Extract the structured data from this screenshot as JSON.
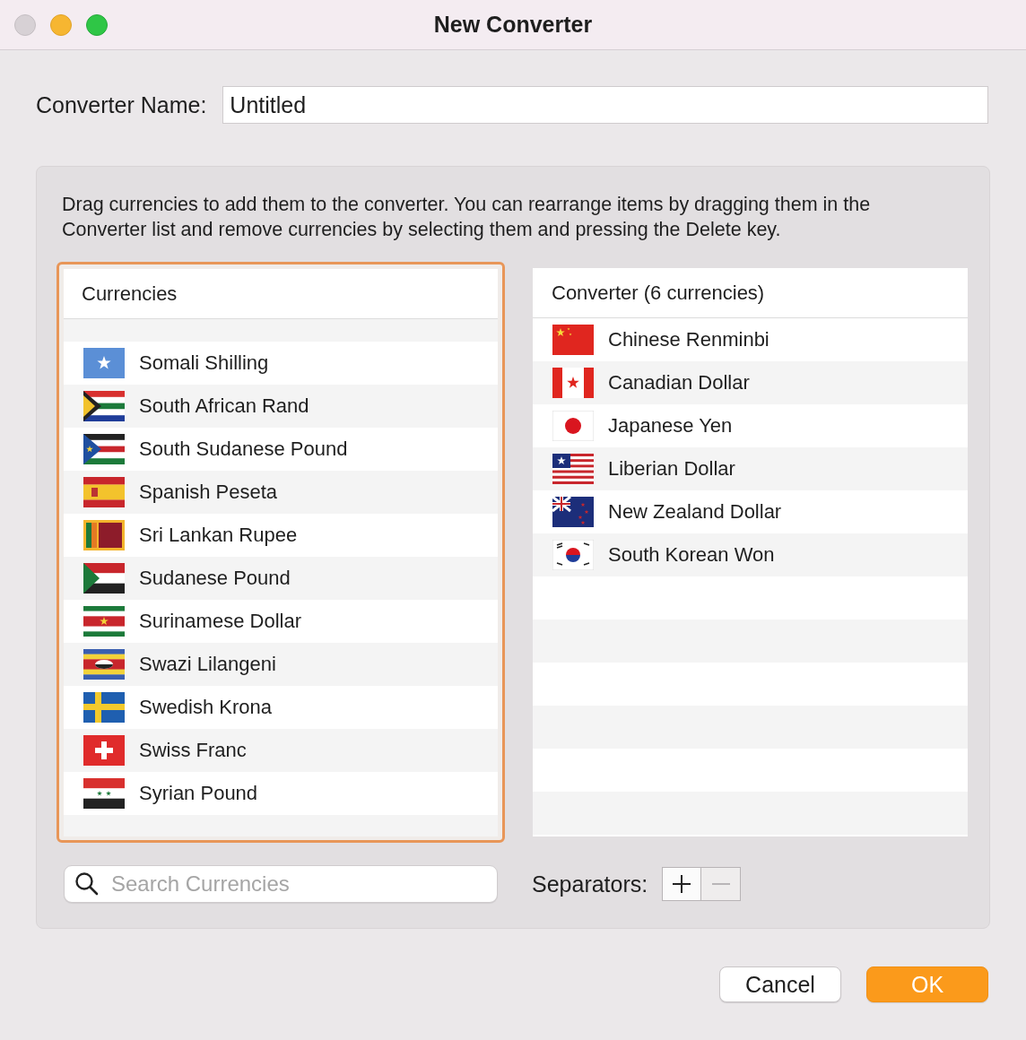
{
  "window": {
    "title": "New Converter"
  },
  "converter_name": {
    "label": "Converter Name:",
    "value": "Untitled"
  },
  "instructions": "Drag currencies to add them to the converter. You can rearrange items by dragging them in the Converter list and remove currencies by selecting them and pressing the Delete key.",
  "currencies": {
    "title": "Currencies",
    "focused": true,
    "items": [
      {
        "name": "Somali Shilling"
      },
      {
        "name": "South African Rand"
      },
      {
        "name": "South Sudanese Pound"
      },
      {
        "name": "Spanish Peseta"
      },
      {
        "name": "Sri Lankan Rupee"
      },
      {
        "name": "Sudanese Pound"
      },
      {
        "name": "Surinamese Dollar"
      },
      {
        "name": "Swazi Lilangeni"
      },
      {
        "name": "Swedish Krona"
      },
      {
        "name": "Swiss Franc"
      },
      {
        "name": "Syrian Pound"
      }
    ]
  },
  "converter": {
    "title": "Converter (6 currencies)",
    "items": [
      {
        "name": "Chinese Renminbi"
      },
      {
        "name": "Canadian Dollar"
      },
      {
        "name": "Japanese Yen"
      },
      {
        "name": "Liberian Dollar"
      },
      {
        "name": "New Zealand Dollar"
      },
      {
        "name": "South Korean Won"
      }
    ]
  },
  "search": {
    "placeholder": "Search Currencies"
  },
  "separators": {
    "label": "Separators:",
    "remove_disabled": true
  },
  "buttons": [
    {
      "label": "Cancel",
      "kind": "normal"
    },
    {
      "label": "OK",
      "kind": "default"
    }
  ]
}
